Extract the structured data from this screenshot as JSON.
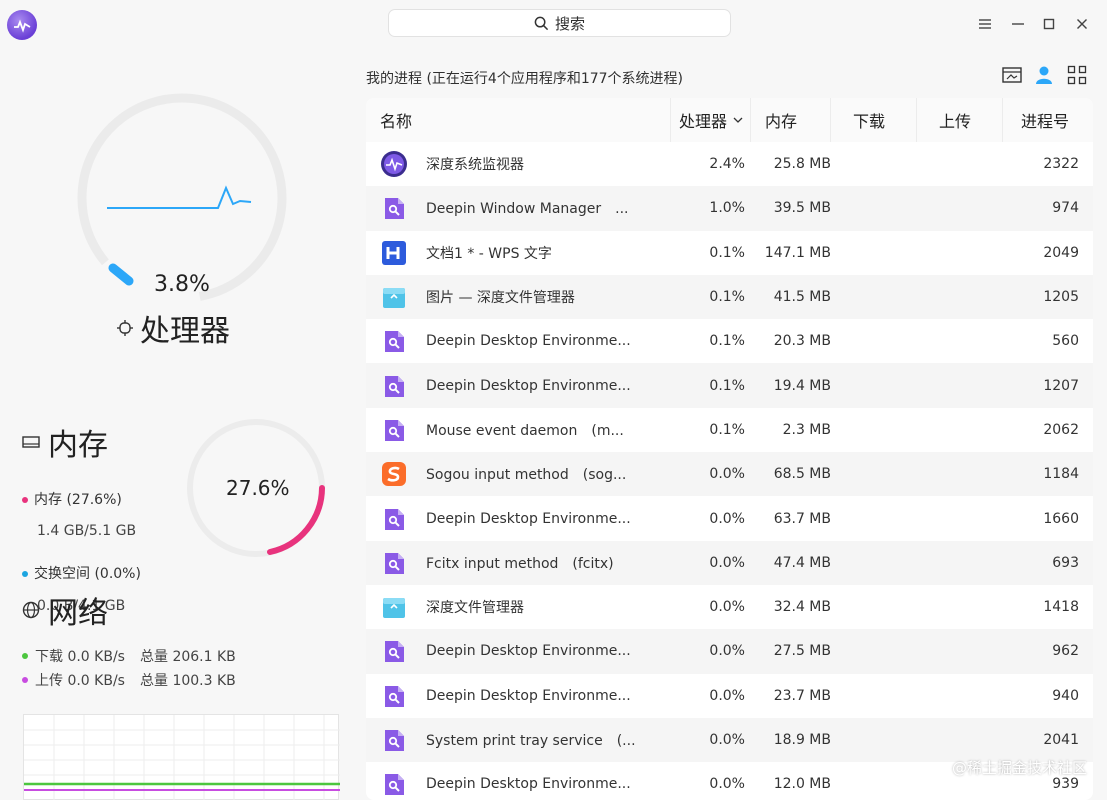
{
  "search": {
    "placeholder": "搜索"
  },
  "cpu": {
    "percent": "3.8%",
    "title": "处理器"
  },
  "memory": {
    "title": "内存",
    "percent": "27.6%",
    "mem_label": "内存 (27.6%)",
    "mem_value": "1.4 GB/5.1 GB",
    "swap_label": "交换空间 (0.0%)",
    "swap_value": "0.0 B/4.1 GB",
    "mem_color": "#e8337d",
    "swap_color": "#1ca5e0"
  },
  "network": {
    "title": "网络",
    "download_label": "下载 0.0 KB/s",
    "download_total": "总量 206.1 KB",
    "upload_label": "上传 0.0 KB/s",
    "upload_total": "总量 100.3 KB",
    "download_color": "#4cc63f",
    "upload_color": "#c84ce0"
  },
  "process_summary": "我的进程 (正在运行4个应用程序和177个系统进程)",
  "columns": {
    "name": "名称",
    "cpu": "处理器",
    "mem": "内存",
    "download": "下载",
    "upload": "上传",
    "pid": "进程号"
  },
  "processes": [
    {
      "icon": "deepin-monitor-icon",
      "name": "深度系统监视器",
      "cpu": "2.4%",
      "mem": "25.8 MB",
      "pid": "2322"
    },
    {
      "icon": "deepin-process-icon",
      "name": "Deepin Window Manager　...",
      "cpu": "1.0%",
      "mem": "39.5 MB",
      "pid": "974"
    },
    {
      "icon": "wps-writer-icon",
      "name": "文档1 * - WPS 文字",
      "cpu": "0.1%",
      "mem": "147.1 MB",
      "pid": "2049"
    },
    {
      "icon": "file-manager-icon",
      "name": "图片 — 深度文件管理器",
      "cpu": "0.1%",
      "mem": "41.5 MB",
      "pid": "1205"
    },
    {
      "icon": "deepin-process-icon",
      "name": "Deepin Desktop Environme...",
      "cpu": "0.1%",
      "mem": "20.3 MB",
      "pid": "560"
    },
    {
      "icon": "deepin-process-icon",
      "name": "Deepin Desktop Environme...",
      "cpu": "0.1%",
      "mem": "19.4 MB",
      "pid": "1207"
    },
    {
      "icon": "deepin-process-icon",
      "name": "Mouse event daemon　(m...",
      "cpu": "0.1%",
      "mem": "2.3 MB",
      "pid": "2062"
    },
    {
      "icon": "sogou-icon",
      "name": "Sogou input method　(sog...",
      "cpu": "0.0%",
      "mem": "68.5 MB",
      "pid": "1184"
    },
    {
      "icon": "deepin-process-icon",
      "name": "Deepin Desktop Environme...",
      "cpu": "0.0%",
      "mem": "63.7 MB",
      "pid": "1660"
    },
    {
      "icon": "deepin-process-icon",
      "name": "Fcitx input method　(fcitx)",
      "cpu": "0.0%",
      "mem": "47.4 MB",
      "pid": "693"
    },
    {
      "icon": "file-manager-icon",
      "name": "深度文件管理器",
      "cpu": "0.0%",
      "mem": "32.4 MB",
      "pid": "1418"
    },
    {
      "icon": "deepin-process-icon",
      "name": "Deepin Desktop Environme...",
      "cpu": "0.0%",
      "mem": "27.5 MB",
      "pid": "962"
    },
    {
      "icon": "deepin-process-icon",
      "name": "Deepin Desktop Environme...",
      "cpu": "0.0%",
      "mem": "23.7 MB",
      "pid": "940"
    },
    {
      "icon": "deepin-process-icon",
      "name": "System print tray service　(...",
      "cpu": "0.0%",
      "mem": "18.9 MB",
      "pid": "2041"
    },
    {
      "icon": "deepin-process-icon",
      "name": "Deepin Desktop Environme...",
      "cpu": "0.0%",
      "mem": "12.0 MB",
      "pid": "939"
    }
  ],
  "watermark": "@稀土掘金技术社区",
  "accent_color": "#2ca7f8"
}
